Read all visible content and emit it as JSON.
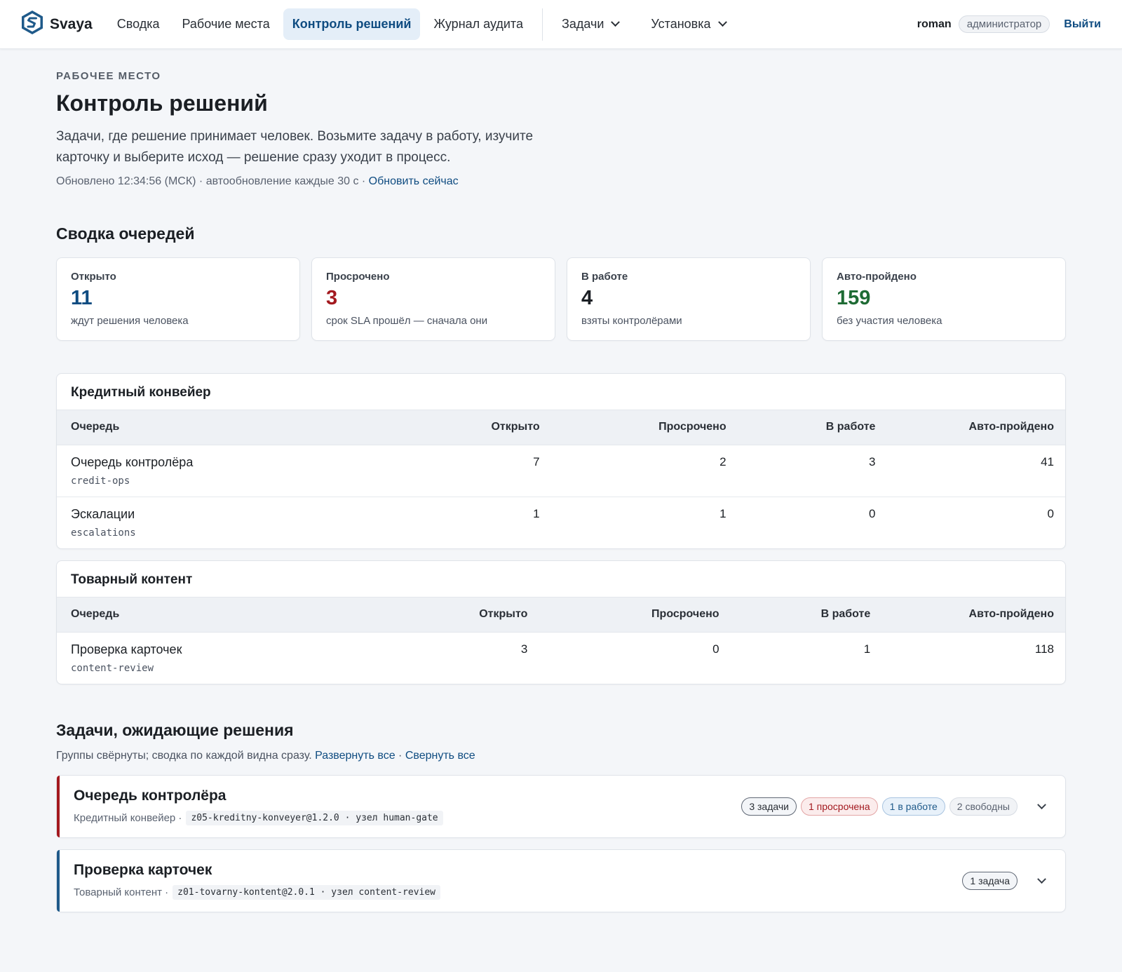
{
  "brand": {
    "name": "Svaya"
  },
  "nav": {
    "items": [
      "Сводка",
      "Рабочие места",
      "Контроль решений",
      "Журнал аудита"
    ],
    "active_index": 2,
    "menus": [
      "Задачи",
      "Установка"
    ]
  },
  "user": {
    "name": "roman",
    "role": "администратор",
    "logout": "Выйти"
  },
  "header": {
    "eyebrow": "РАБОЧЕЕ МЕСТО",
    "title": "Контроль решений",
    "lede": "Задачи, где решение принимает человек. Возьмите задачу в работу, изучите карточку и выберите исход — решение сразу уходит в процесс.",
    "updated_text": "Обновлено 12:34:56 (МСК) · автообновление каждые 30 с ·",
    "refresh_link": "Обновить сейчас"
  },
  "summary": {
    "title": "Сводка очередей",
    "cards": [
      {
        "label": "Открыто",
        "value": "11",
        "sub": "ждут решения человека",
        "color": "#0f4c81"
      },
      {
        "label": "Просрочено",
        "value": "3",
        "sub": "срок SLA прошёл — сначала они",
        "color": "#a3191f"
      },
      {
        "label": "В работе",
        "value": "4",
        "sub": "взяты контролёрами",
        "color": "#1b1f24"
      },
      {
        "label": "Авто-пройдено",
        "value": "159",
        "sub": "без участия человека",
        "color": "#1e6b34"
      }
    ]
  },
  "tables": [
    {
      "title": "Кредитный конвейер",
      "columns": [
        "Очередь",
        "Открыто",
        "Просрочено",
        "В работе",
        "Авто-пройдено"
      ],
      "rows": [
        {
          "name": "Очередь контролёра",
          "code": "credit-ops",
          "open": "7",
          "overdue": "2",
          "in_work": "3",
          "auto": "41"
        },
        {
          "name": "Эскалации",
          "code": "escalations",
          "open": "1",
          "overdue": "1",
          "in_work": "0",
          "auto": "0"
        }
      ]
    },
    {
      "title": "Товарный контент",
      "columns": [
        "Очередь",
        "Открыто",
        "Просрочено",
        "В работе",
        "Авто-пройдено"
      ],
      "rows": [
        {
          "name": "Проверка карточек",
          "code": "content-review",
          "open": "3",
          "overdue": "0",
          "in_work": "1",
          "auto": "118"
        }
      ]
    }
  ],
  "pending": {
    "title": "Задачи, ожидающие решения",
    "hint": "Группы свёрнуты; сводка по каждой видна сразу.",
    "expand_all": "Развернуть все",
    "collapse_all": "Свернуть все",
    "groups": [
      {
        "title": "Очередь контролёра",
        "pipeline": "Кредитный конвейер ·",
        "code": "z05-kreditny-konveyer@1.2.0 · узел human-gate",
        "badges": [
          "3 задачи",
          "1 просрочена",
          "1 в работе",
          "2 свободны"
        ]
      },
      {
        "title": "Проверка карточек",
        "pipeline": "Товарный контент ·",
        "code": "z01-tovarny-kontent@2.0.1 · узел content-review",
        "badges": [
          "1 задача"
        ]
      }
    ]
  }
}
